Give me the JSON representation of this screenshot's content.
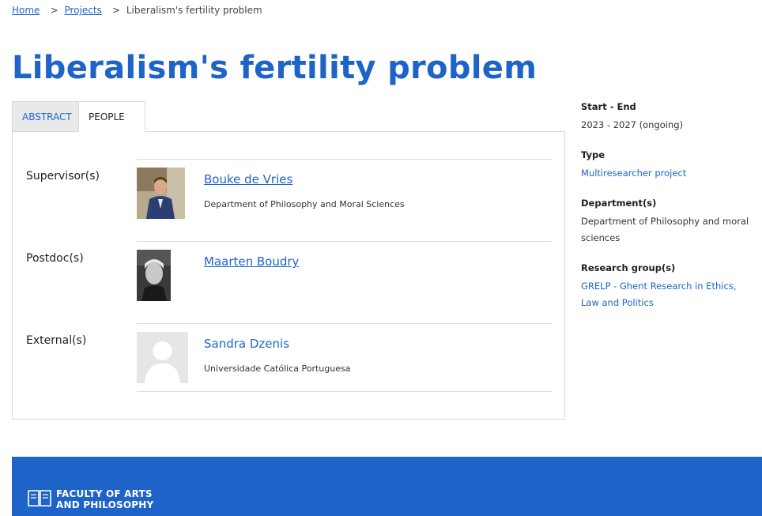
{
  "breadcrumb": {
    "home": "Home",
    "projects": "Projects",
    "sep1": ">",
    "sep2": ">",
    "current": "Liberalism's fertility problem"
  },
  "page_title": "Liberalism's fertility problem",
  "tabs": [
    {
      "label": "ABSTRACT",
      "active": false
    },
    {
      "label": "PEOPLE",
      "active": true
    }
  ],
  "people": [
    {
      "role": "Supervisor(s)",
      "name": "Bouke de Vries",
      "affiliation": "Department of Philosophy and Moral Sciences",
      "linked": true,
      "photo": "portrait-suit"
    },
    {
      "role": "Postdoc(s)",
      "name": "Maarten Boudry",
      "affiliation": "",
      "linked": true,
      "photo": "portrait-bw"
    },
    {
      "role": "External(s)",
      "name": "Sandra Dzenis",
      "affiliation": "Universidade Católica Portuguesa",
      "linked": false,
      "photo": "placeholder-avatar"
    }
  ],
  "sidebar": {
    "start_end_label": "Start - End",
    "start_end_value": "2023 - 2027 (ongoing)",
    "type_label": "Type",
    "type_value": "Multiresearcher project",
    "department_label": "Department(s)",
    "department_value": "Department of Philosophy and moral sciences",
    "research_group_label": "Research group(s)",
    "research_group_value": "GRELP - Ghent Research in Ethics, Law and Politics"
  },
  "footer": {
    "logo_line1": "FACULTY OF ARTS",
    "logo_line2": "AND PHILOSOPHY",
    "logo_icon": "open-book-icon"
  },
  "colors": {
    "brand_blue": "#1e64c8",
    "border": "#d9d9d9",
    "tab_inactive_bg": "#e9e9e9"
  }
}
